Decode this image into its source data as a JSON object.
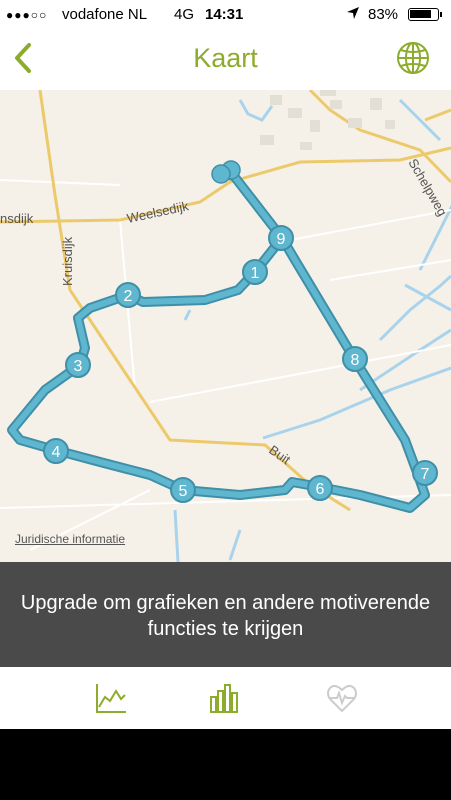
{
  "status": {
    "signal_dots": "●●●○○",
    "carrier": "vodafone NL",
    "network": "4G",
    "time": "14:31",
    "location_icon": "location-arrow-icon",
    "battery_percent": "83%",
    "battery_level": 0.83
  },
  "nav": {
    "title": "Kaart",
    "back_icon": "chevron-left-icon",
    "globe_icon": "globe-icon",
    "accent": "#8dab2c"
  },
  "map": {
    "roads": [
      "nsdijk",
      "Weelsedijk",
      "Kruisdijk",
      "Buit",
      "Schelpweg"
    ],
    "markers": [
      "1",
      "2",
      "3",
      "4",
      "5",
      "6",
      "7",
      "8",
      "9"
    ],
    "legal_link": "Juridische informatie",
    "route_color": "#5fb6cf"
  },
  "promo": {
    "text": "Upgrade om grafieken en andere motiverende functies te krijgen"
  },
  "tabs": [
    {
      "icon": "line-chart-icon"
    },
    {
      "icon": "bar-chart-icon"
    },
    {
      "icon": "heart-rate-icon"
    }
  ]
}
